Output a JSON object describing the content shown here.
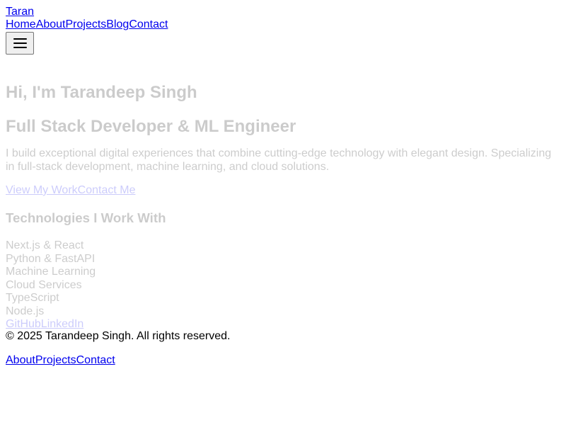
{
  "header": {
    "brand": "Taran",
    "nav": [
      "Home",
      "About",
      "Projects",
      "Blog",
      "Contact"
    ],
    "menu_icon": "hamburger-icon"
  },
  "hero": {
    "title": "Hi, I'm Tarandeep Singh",
    "subtitle": "Full Stack Developer & ML Engineer",
    "description": "I build exceptional digital experiences that combine cutting-edge technology with elegant design. Specializing in full-stack development, machine learning, and cloud solutions.",
    "cta_primary": "View My Work",
    "cta_secondary": "Contact Me"
  },
  "tech": {
    "heading": "Technologies I Work With",
    "items": [
      "Next.js & React",
      "Python & FastAPI",
      "Machine Learning",
      "Cloud Services",
      "TypeScript",
      "Node.js"
    ]
  },
  "social": {
    "links": [
      "GitHub",
      "LinkedIn"
    ]
  },
  "footer": {
    "copyright": "© 2025 Tarandeep Singh. All rights reserved.",
    "links": [
      "About",
      "Projects",
      "Contact"
    ]
  },
  "colors": {
    "link": "#0000ee",
    "text": "#000000",
    "faded_text": "#cccccc",
    "background": "#ffffff"
  }
}
